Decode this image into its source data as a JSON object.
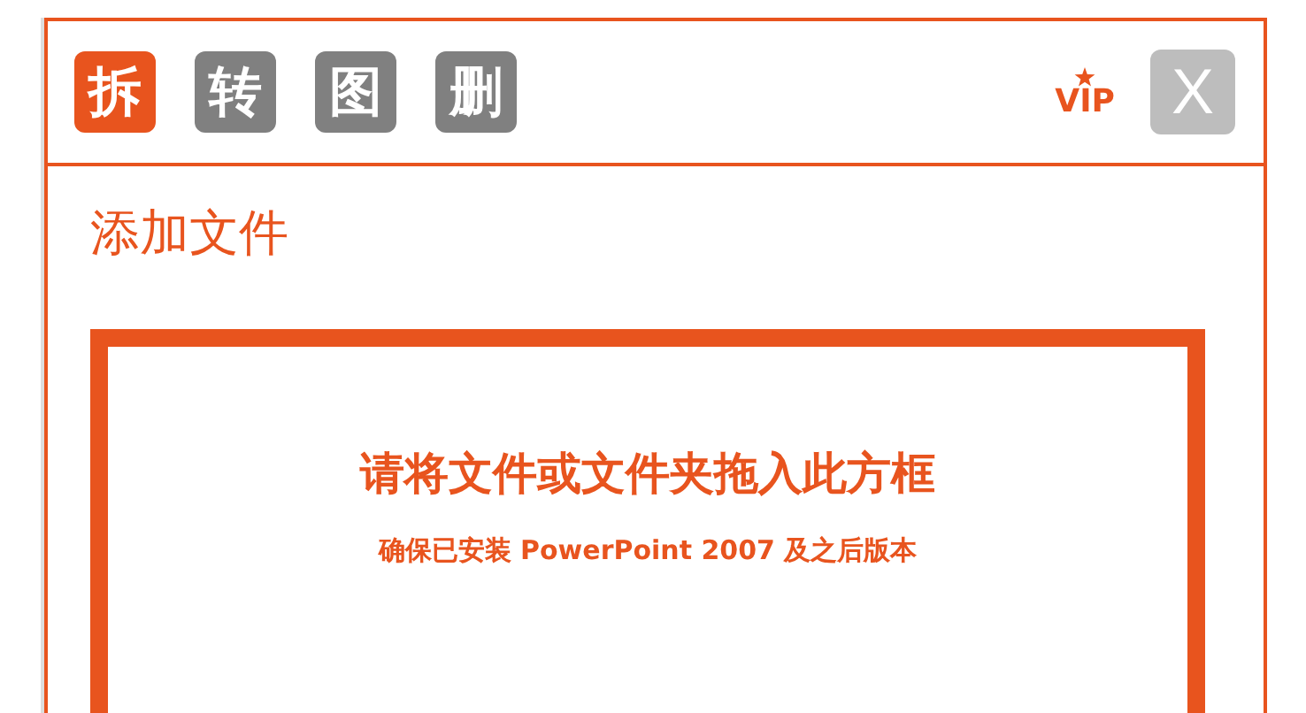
{
  "toolbar": {
    "tabs": [
      {
        "label": "拆",
        "selected": true
      },
      {
        "label": "转",
        "selected": false
      },
      {
        "label": "图",
        "selected": false
      },
      {
        "label": "删",
        "selected": false
      }
    ],
    "vip": "VIP",
    "close": "X"
  },
  "section_title": "添加文件",
  "drop_zone": {
    "title": "请将文件或文件夹拖入此方框",
    "note": "确保已安装 PowerPoint 2007 及之后版本"
  }
}
